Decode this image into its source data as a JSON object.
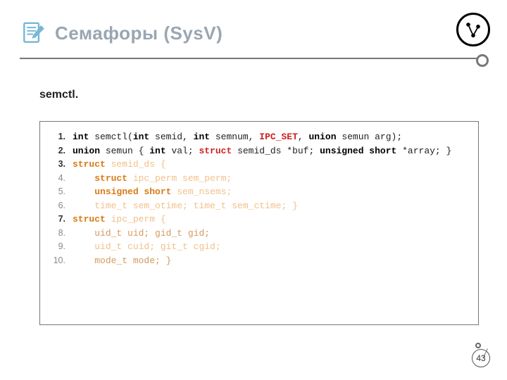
{
  "header": {
    "title": "Семафоры (SysV)"
  },
  "subtitle": "semctl.",
  "code": {
    "lines": [
      {
        "num": "1.",
        "boldNum": true,
        "segments": [
          {
            "t": "int",
            "cls": "kw1"
          },
          {
            "t": " semctl("
          },
          {
            "t": "int",
            "cls": "kw1"
          },
          {
            "t": " semid, "
          },
          {
            "t": "int",
            "cls": "kw1"
          },
          {
            "t": " semnum, "
          },
          {
            "t": "IPC_SET",
            "cls": "kw-red"
          },
          {
            "t": ", "
          },
          {
            "t": "union",
            "cls": "kw1"
          },
          {
            "t": " semun arg);"
          }
        ]
      },
      {
        "num": "2.",
        "boldNum": true,
        "segments": [
          {
            "t": "union",
            "cls": "kw1"
          },
          {
            "t": " semun { "
          },
          {
            "t": "int",
            "cls": "kw1"
          },
          {
            "t": " val; "
          },
          {
            "t": "struct",
            "cls": "kw-red"
          },
          {
            "t": " semid_ds *buf; "
          },
          {
            "t": "unsigned short",
            "cls": "kw1"
          },
          {
            "t": " *array; }"
          }
        ]
      },
      {
        "num": "3.",
        "boldNum": true,
        "segments": [
          {
            "t": "struct",
            "cls": "kw-orange"
          },
          {
            "t": " semid_ds {",
            "cls": "faded"
          }
        ]
      },
      {
        "num": "4.",
        "boldNum": false,
        "segments": [
          {
            "t": "    "
          },
          {
            "t": "struct",
            "cls": "kw-orange"
          },
          {
            "t": " ipc_perm sem_perm;",
            "cls": "faded"
          }
        ]
      },
      {
        "num": "5.",
        "boldNum": false,
        "segments": [
          {
            "t": "    "
          },
          {
            "t": "unsigned short",
            "cls": "kw-orange"
          },
          {
            "t": " sem_nsems;",
            "cls": "faded"
          }
        ]
      },
      {
        "num": "6.",
        "boldNum": false,
        "segments": [
          {
            "t": "    "
          },
          {
            "t": "time_t sem_otime; time_t sem_ctime; }",
            "cls": "faded"
          }
        ]
      },
      {
        "num": "7.",
        "boldNum": true,
        "segments": [
          {
            "t": "struct",
            "cls": "kw-orange"
          },
          {
            "t": " ipc_perm {",
            "cls": "faded"
          }
        ]
      },
      {
        "num": "8.",
        "boldNum": false,
        "segments": [
          {
            "t": "    "
          },
          {
            "t": "uid_t uid; gid_t gid;",
            "cls": "mid"
          }
        ]
      },
      {
        "num": "9.",
        "boldNum": false,
        "segments": [
          {
            "t": "    "
          },
          {
            "t": "uid_t cuid; git_t cgid;",
            "cls": "faded"
          }
        ]
      },
      {
        "num": "10.",
        "boldNum": false,
        "segments": [
          {
            "t": "    "
          },
          {
            "t": "mode_t mode; }",
            "cls": "mid"
          }
        ]
      }
    ]
  },
  "page_number": "43"
}
